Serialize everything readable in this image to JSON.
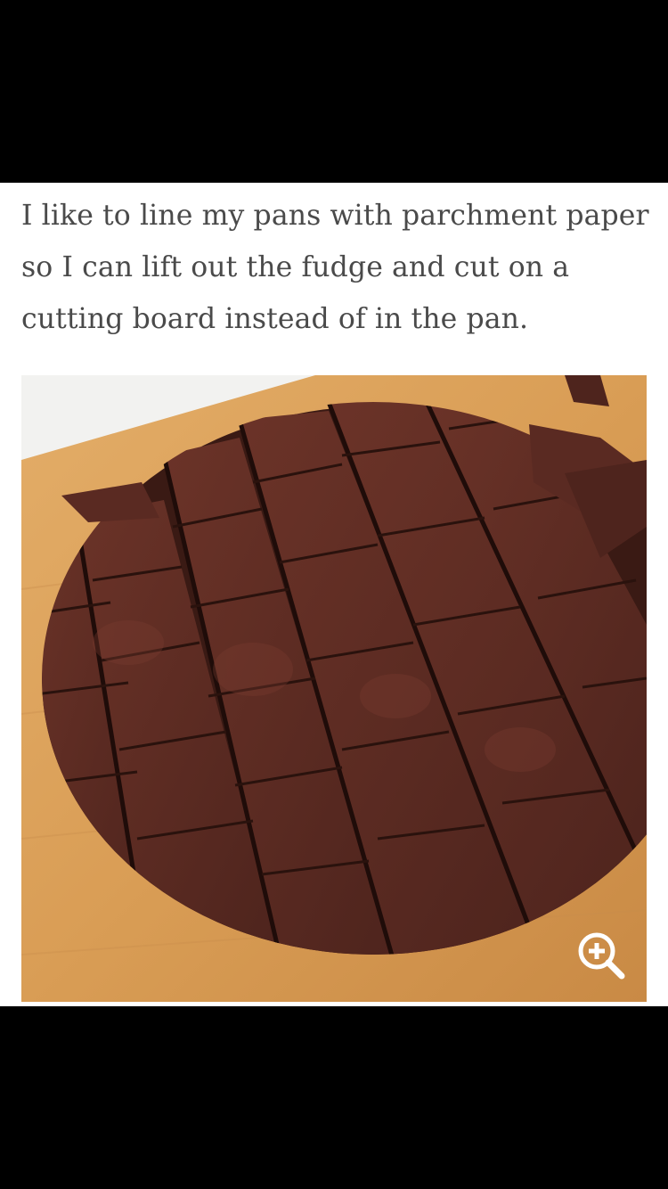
{
  "post": {
    "caption": "I like to line my pans with parchment paper so I can lift out the fudge and cut on a cutting board instead of in the pan.",
    "image_alt_icon": "fudge-photo",
    "zoom_icon": "zoom-in-icon"
  },
  "colors": {
    "background": "#000000",
    "content_background": "#ffffff",
    "caption_text": "#4a4a4a",
    "board_wood": "#d9a15c",
    "fudge": "#5a2a22",
    "zoom_icon": "#ffffff"
  }
}
